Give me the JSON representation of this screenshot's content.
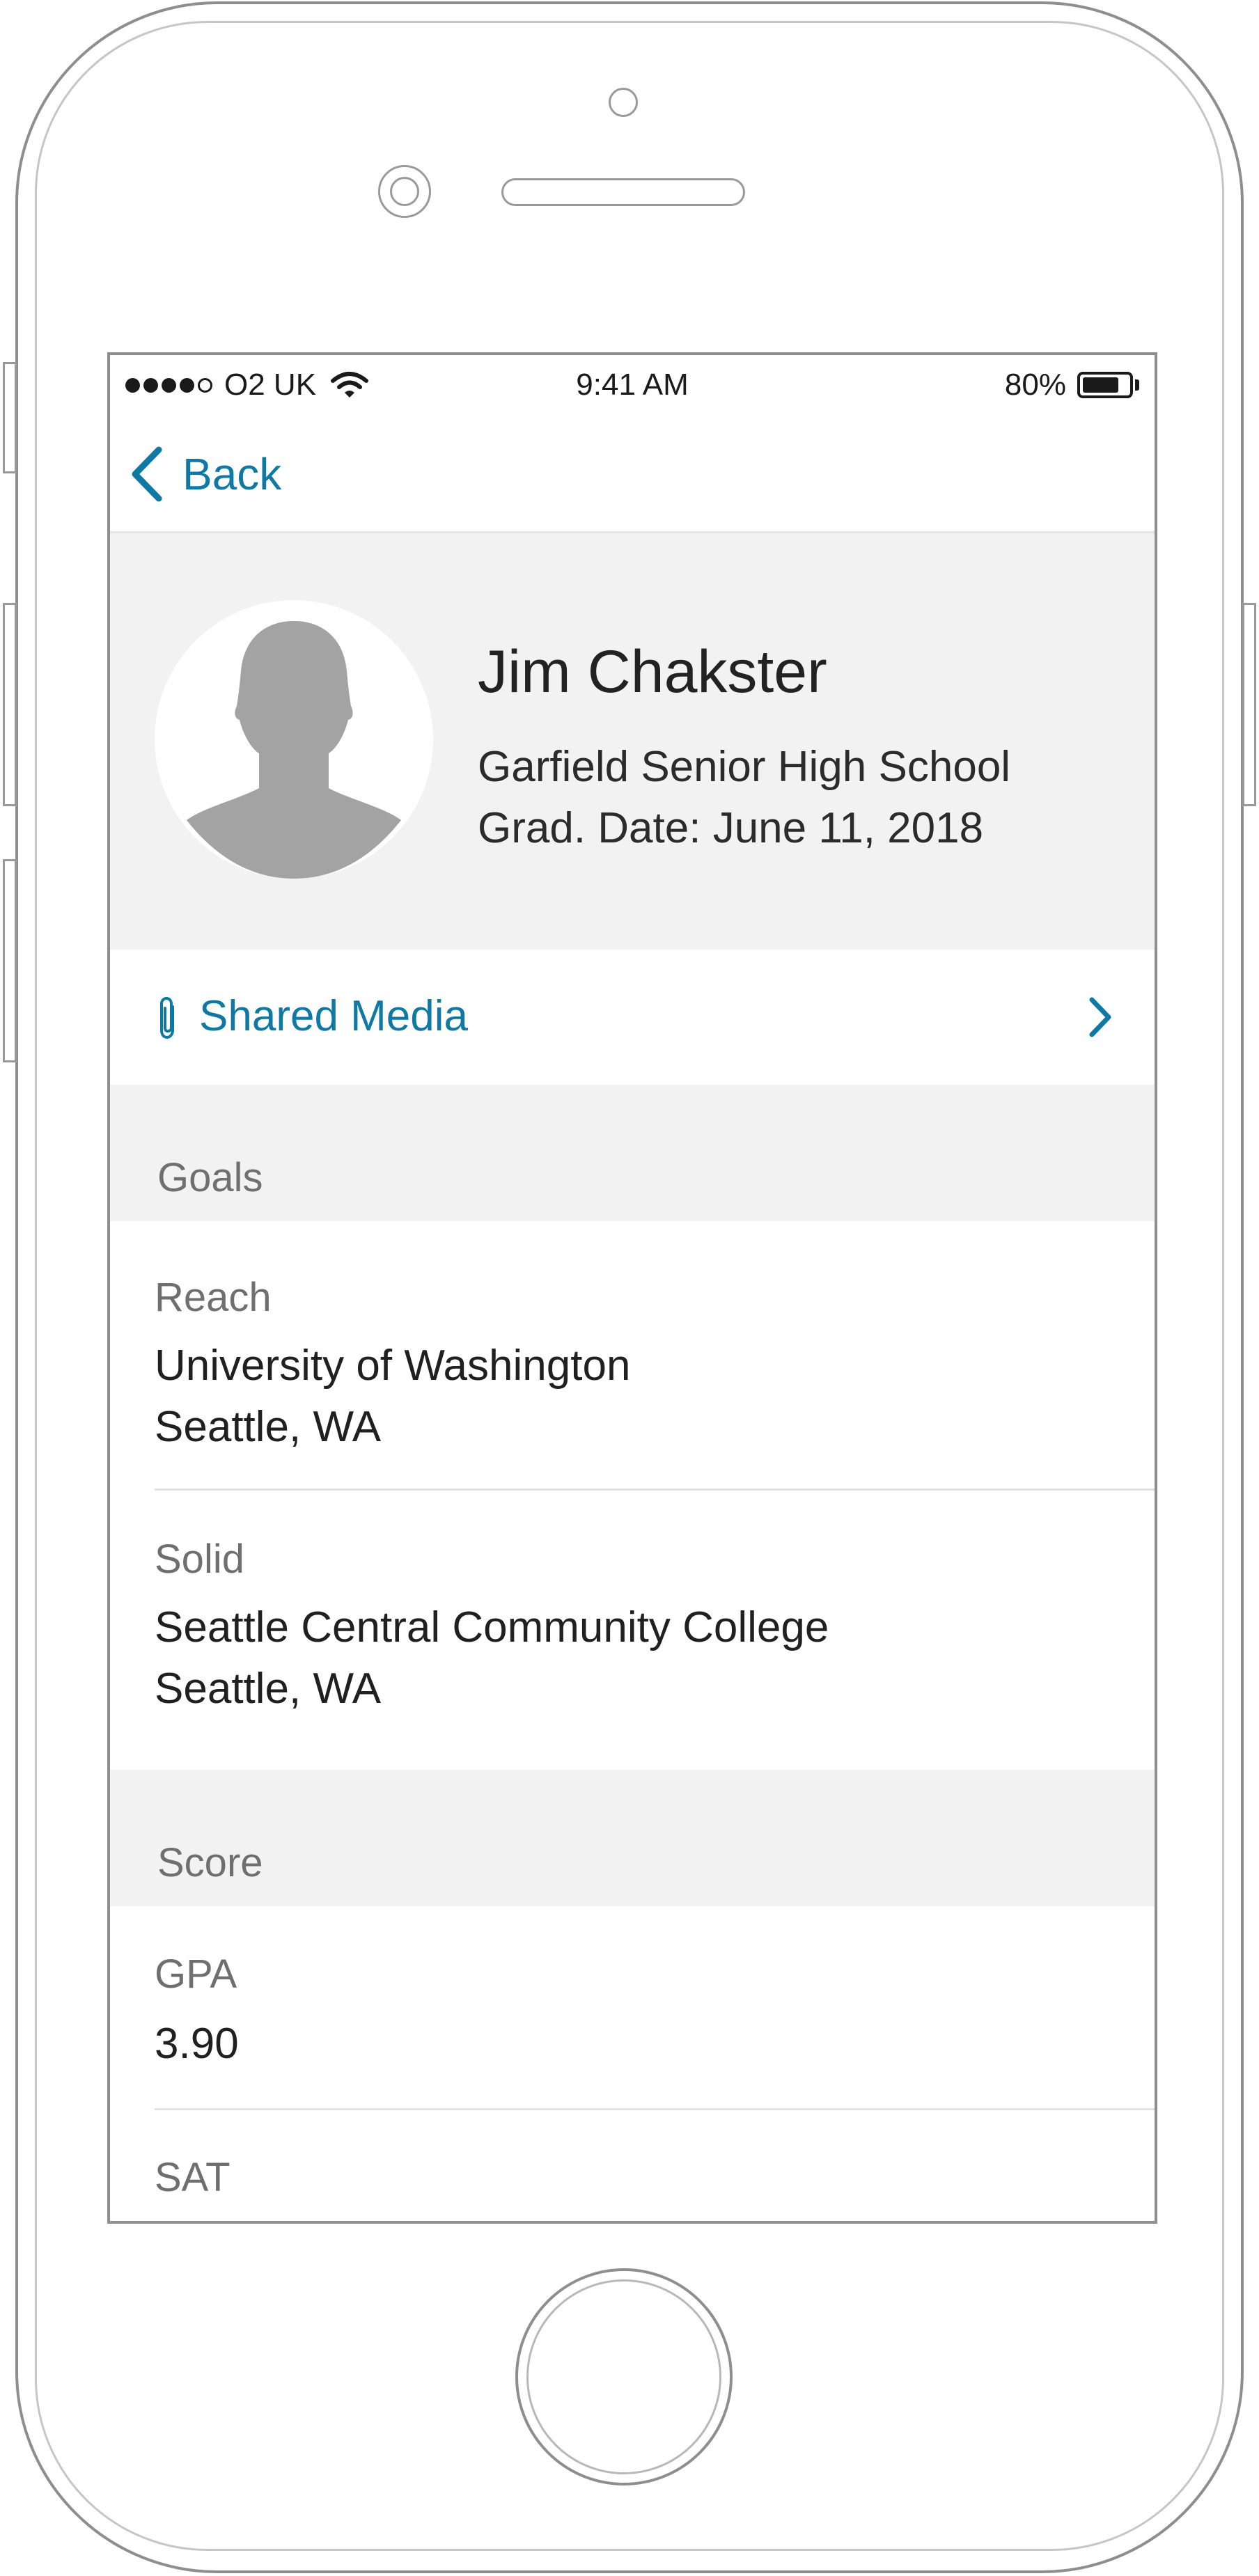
{
  "status_bar": {
    "carrier": "O2 UK",
    "time": "9:41 AM",
    "battery_percent": "80%",
    "battery_level": 0.8
  },
  "nav": {
    "back_label": "Back",
    "accent_color": "#0f79a6"
  },
  "profile": {
    "name": "Jim Chakster",
    "school": "Garfield Senior High School",
    "grad_date": "Grad. Date: June 11, 2018"
  },
  "shared_media": {
    "label": "Shared Media"
  },
  "goals": {
    "title": "Goals",
    "items": [
      {
        "label": "Reach",
        "name": "University of Washington",
        "location": "Seattle, WA"
      },
      {
        "label": "Solid",
        "name": "Seattle Central Community College",
        "location": "Seattle, WA"
      }
    ]
  },
  "score": {
    "title": "Score",
    "items": [
      {
        "label": "GPA",
        "value": "3.90"
      },
      {
        "label": "SAT",
        "value": ""
      }
    ]
  }
}
